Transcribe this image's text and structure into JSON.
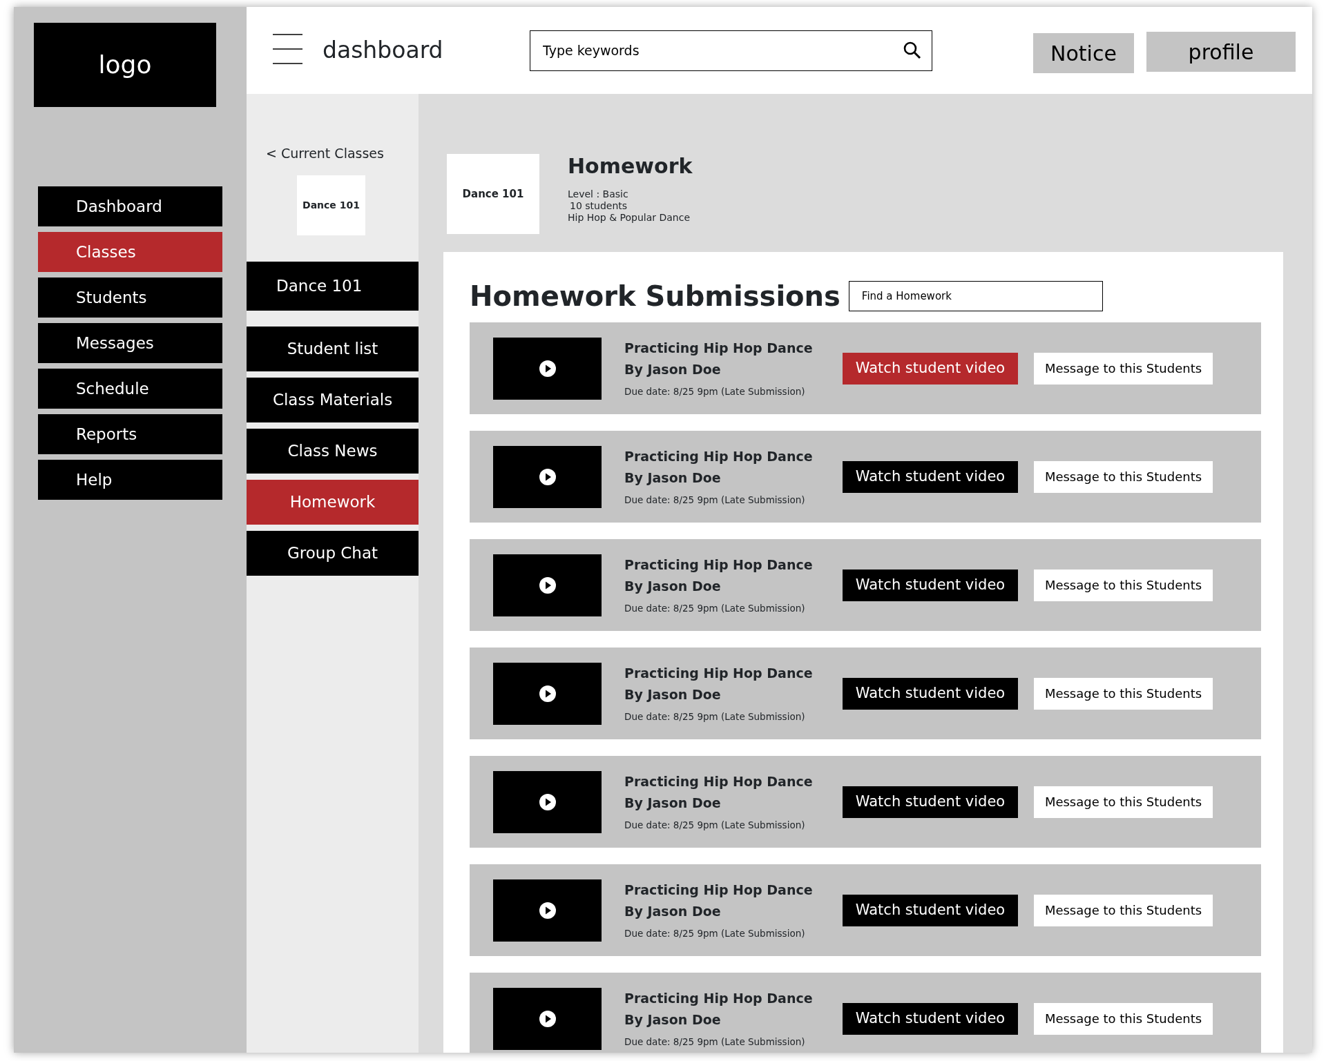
{
  "sidebar": {
    "logo": "logo",
    "items": [
      {
        "label": "Dashboard",
        "selected": false
      },
      {
        "label": "Classes",
        "selected": true
      },
      {
        "label": "Students",
        "selected": false
      },
      {
        "label": "Messages",
        "selected": false
      },
      {
        "label": "Schedule",
        "selected": false
      },
      {
        "label": "Reports",
        "selected": false
      },
      {
        "label": "Help",
        "selected": false
      }
    ]
  },
  "header": {
    "title": "dashboard",
    "search": {
      "placeholder": "Type keywords"
    },
    "buttons": [
      "Notice",
      "profile"
    ]
  },
  "class_menu": {
    "back": "< Current Classes",
    "class_card": "Dance 101",
    "items": [
      {
        "label": "Dance 101",
        "selected": false
      },
      {
        "label": "Student list",
        "selected": false
      },
      {
        "label": "Class Materials",
        "selected": false
      },
      {
        "label": "Class News",
        "selected": false
      },
      {
        "label": "Homework",
        "selected": true
      },
      {
        "label": "Group Chat",
        "selected": false
      }
    ]
  },
  "class_info": {
    "card": "Dance 101",
    "title": "Homework",
    "details": [
      "Level : Basic",
      "10 students",
      "Hip Hop  & Popular Dance"
    ]
  },
  "submissions": {
    "title": "Homework Submissions",
    "search": {
      "placeholder": "Find a Homework"
    },
    "rows": [
      {
        "title": "Practicing Hip Hop Dance",
        "student": "By Jason Doe",
        "due": "Due date:  8/25 9pm  (Late Submission)",
        "watch": "Watch student video",
        "watch_selected": true,
        "message": "Message to this Students"
      },
      {
        "title": "Practicing Hip Hop Dance",
        "student": "By Jason Doe",
        "due": "Due date:  8/25 9pm  (Late Submission)",
        "watch": "Watch student video",
        "watch_selected": false,
        "message": "Message to this Students"
      },
      {
        "title": "Practicing Hip Hop Dance",
        "student": "By Jason Doe",
        "due": "Due date:  8/25 9pm  (Late Submission)",
        "watch": "Watch student video",
        "watch_selected": false,
        "message": "Message to this Students"
      },
      {
        "title": "Practicing Hip Hop Dance",
        "student": "By Jason Doe",
        "due": "Due date:  8/25 9pm  (Late Submission)",
        "watch": "Watch student video",
        "watch_selected": false,
        "message": "Message to this Students"
      },
      {
        "title": "Practicing Hip Hop Dance",
        "student": "By Jason Doe",
        "due": "Due date:  8/25 9pm  (Late Submission)",
        "watch": "Watch student video",
        "watch_selected": false,
        "message": "Message to this Students"
      },
      {
        "title": "Practicing Hip Hop Dance",
        "student": "By Jason Doe",
        "due": "Due date:  8/25 9pm  (Late Submission)",
        "watch": "Watch student video",
        "watch_selected": false,
        "message": "Message to this Students"
      },
      {
        "title": "Practicing Hip Hop Dance",
        "student": "By Jason Doe",
        "due": "Due date:  8/25 9pm  (Late Submission)",
        "watch": "Watch student video",
        "watch_selected": false,
        "message": "Message to this Students"
      }
    ]
  }
}
